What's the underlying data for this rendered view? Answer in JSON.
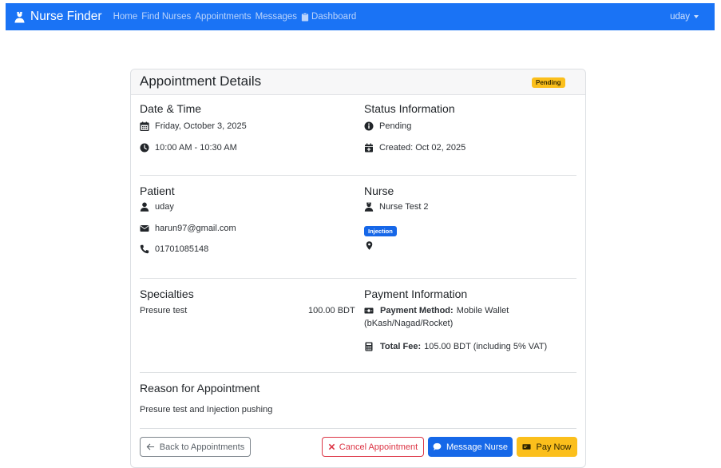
{
  "nav": {
    "brand": "Nurse Finder",
    "links": [
      "Home",
      "Find Nurses",
      "Appointments",
      "Messages",
      "Dashboard"
    ],
    "user": "uday"
  },
  "card": {
    "title": "Appointment Details",
    "status_badge": "Pending"
  },
  "datetime": {
    "title": "Date & Time",
    "date": "Friday, October 3, 2025",
    "time": "10:00 AM - 10:30 AM"
  },
  "status": {
    "title": "Status Information",
    "status": "Pending",
    "created": "Created: Oct 02, 2025"
  },
  "patient": {
    "title": "Patient",
    "name": "uday",
    "email": "harun97@gmail.com",
    "phone": "01701085148"
  },
  "nurse": {
    "title": "Nurse",
    "name": "Nurse Test 2",
    "specialty_badge": "Injection"
  },
  "specialties": {
    "title": "Specialties",
    "items": [
      {
        "name": "Presure test",
        "price": "100.00 BDT"
      }
    ]
  },
  "payment": {
    "title": "Payment Information",
    "method_label": "Payment Method:",
    "method_value": "Mobile Wallet",
    "method_value_2": "(bKash/Nagad/Rocket)",
    "fee_label": "Total Fee:",
    "fee_value": "105.00 BDT (including 5% VAT)"
  },
  "reason": {
    "title": "Reason for Appointment",
    "text": "Presure test and Injection pushing"
  },
  "buttons": {
    "back": "Back to Appointments",
    "cancel": "Cancel Appointment",
    "message": "Message Nurse",
    "pay": "Pay Now"
  },
  "colors": {
    "navbar": "#1a73f5",
    "primary": "#1668e8",
    "warning": "#fbbf1c",
    "danger": "#dc3545"
  }
}
